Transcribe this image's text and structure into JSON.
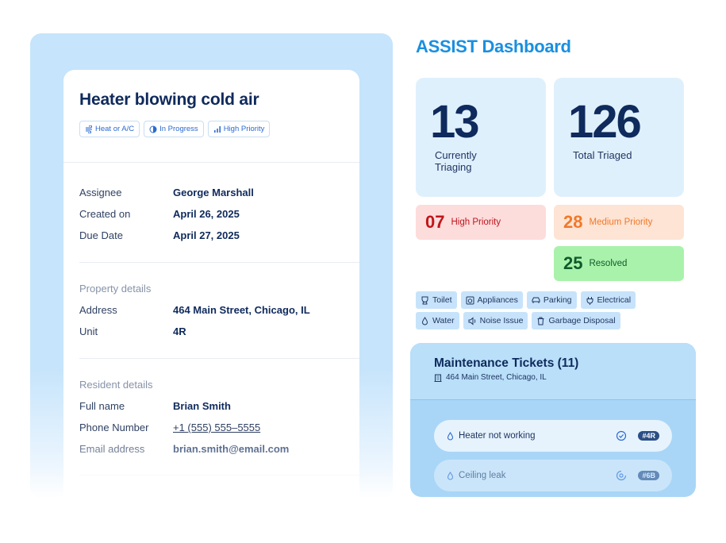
{
  "ticket": {
    "title": "Heater blowing cold air",
    "tags": [
      {
        "label": "Heat or A/C",
        "icon": "fan-icon"
      },
      {
        "label": "In Progress",
        "icon": "progress-icon"
      },
      {
        "label": "High Priority",
        "icon": "bars-icon"
      }
    ],
    "details": [
      {
        "label": "Assignee",
        "value": "George Marshall"
      },
      {
        "label": "Created on",
        "value": "April 26, 2025"
      },
      {
        "label": "Due Date",
        "value": "April 27, 2025"
      }
    ],
    "property": {
      "heading": "Property details",
      "rows": [
        {
          "label": "Address",
          "value": "464 Main Street, Chicago, IL"
        },
        {
          "label": "Unit",
          "value": "4R"
        }
      ]
    },
    "resident": {
      "heading": "Resident details",
      "rows": [
        {
          "label": "Full name",
          "value": "Brian Smith"
        },
        {
          "label": "Phone Number",
          "value": "+1 (555) 555–5555"
        },
        {
          "label": "Email address",
          "value": "brian.smith@email.com"
        }
      ]
    }
  },
  "dashboard": {
    "title": "ASSIST Dashboard",
    "stats": [
      {
        "value": "13",
        "label": "Currently Triaging"
      },
      {
        "value": "126",
        "label": "Total Triaged"
      }
    ],
    "priorities": [
      {
        "value": "07",
        "label": "High Priority",
        "color": "#c0161b",
        "bg": "#fddcdc"
      },
      {
        "value": "28",
        "label": "Medium Priority",
        "color": "#f2782a",
        "bg": "#fde4d4"
      },
      {
        "value": "25",
        "label": "Resolved",
        "color": "#0f5a2a",
        "bg": "#a9f2ab"
      }
    ],
    "categories_row1": [
      {
        "label": "Toilet",
        "icon": "toilet-icon"
      },
      {
        "label": "Appliances",
        "icon": "appliance-icon"
      },
      {
        "label": "Parking",
        "icon": "car-icon"
      },
      {
        "label": "Electrical",
        "icon": "plug-icon"
      }
    ],
    "categories_row2": [
      {
        "label": "Water",
        "icon": "water-drop-icon"
      },
      {
        "label": "Noise Issue",
        "icon": "speaker-icon"
      },
      {
        "label": "Garbage Disposal",
        "icon": "trash-icon"
      }
    ]
  },
  "maintenance": {
    "title": "Maintenance Tickets (11)",
    "address": "464 Main Street, Chicago, IL",
    "tickets": [
      {
        "name": "Heater not working",
        "unit": "#4R",
        "status_icon": "check-circle-icon"
      },
      {
        "name": "Ceiling leak",
        "unit": "#6B",
        "status_icon": "progress-circle-icon"
      }
    ]
  }
}
